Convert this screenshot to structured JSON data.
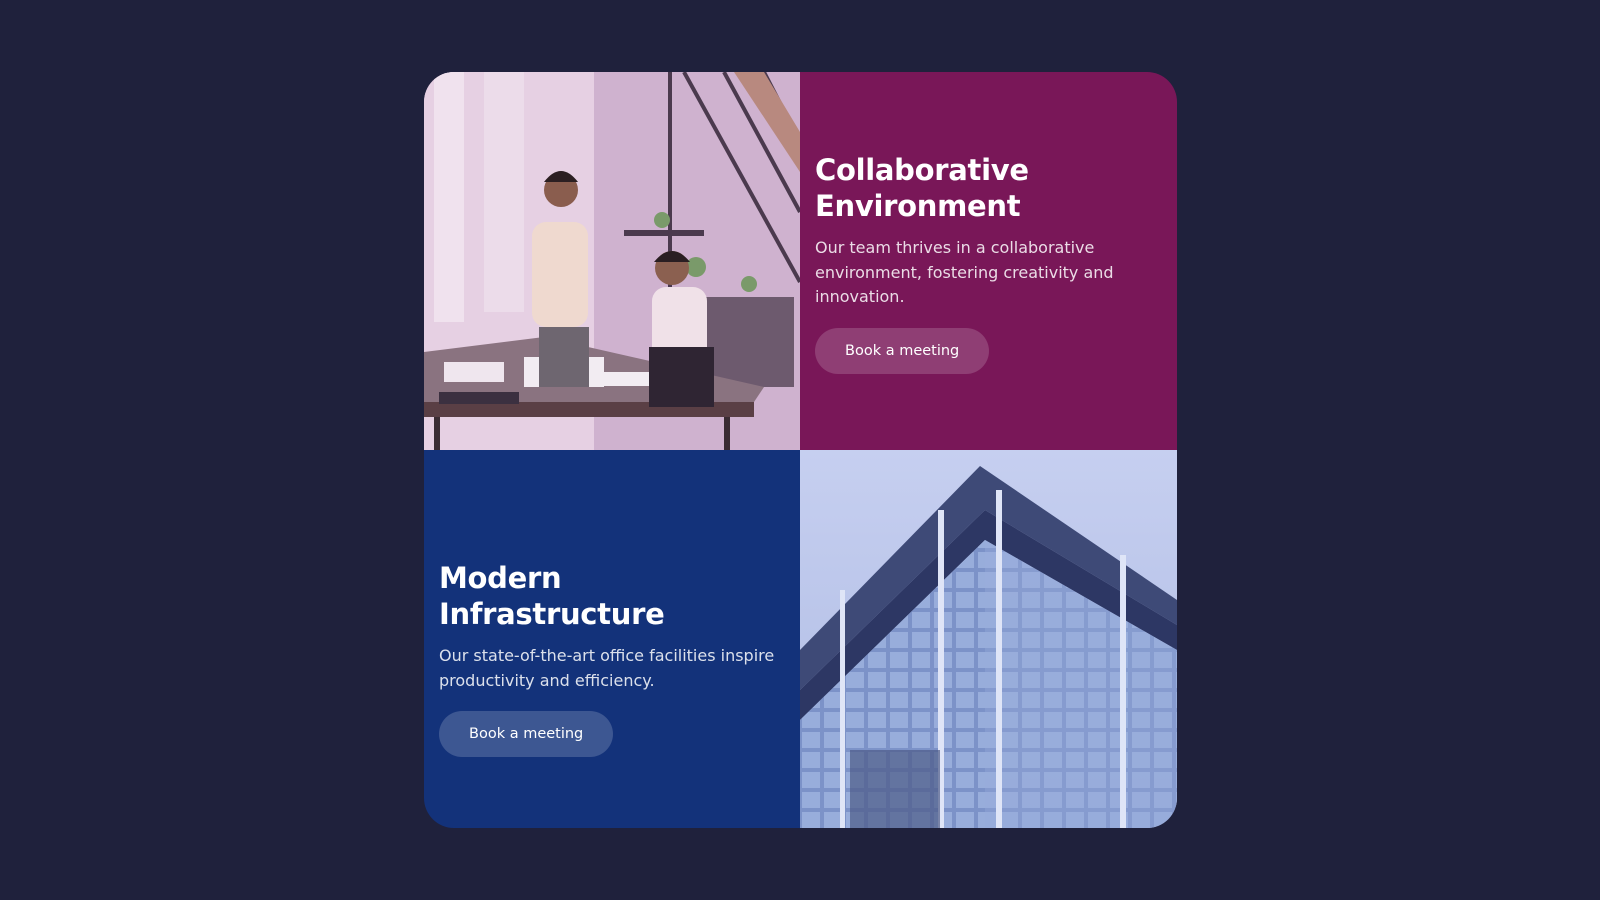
{
  "features": [
    {
      "title": "Collaborative Environment",
      "title_line1": "Collaborative",
      "title_line2": "Environment",
      "description": "Our team thrives in a collaborative environment, fostering creativity and innovation.",
      "button_label": "Book a meeting",
      "background": "#791758",
      "image": "office-team-photo"
    },
    {
      "title": "Modern Infrastructure",
      "description": "Our state-of-the-art office facilities inspire productivity and efficiency.",
      "button_label": "Book a meeting",
      "background": "#13327a",
      "image": "office-building-photo"
    }
  ],
  "colors": {
    "page_background": "#1f213c",
    "purple_panel": "#791758",
    "blue_panel": "#13327a"
  }
}
